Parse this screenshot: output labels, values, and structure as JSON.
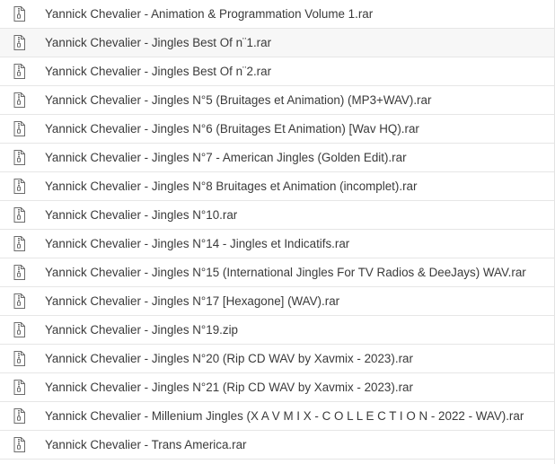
{
  "files": [
    {
      "name": "Yannick Chevalier - Animation & Programmation Volume 1.rar",
      "icon": "archive-file-icon"
    },
    {
      "name": "Yannick Chevalier - Jingles Best Of n¨1.rar",
      "icon": "archive-file-icon"
    },
    {
      "name": "Yannick Chevalier - Jingles Best Of n¨2.rar",
      "icon": "archive-file-icon"
    },
    {
      "name": "Yannick Chevalier - Jingles N°5 (Bruitages et Animation) (MP3+WAV).rar",
      "icon": "archive-file-icon"
    },
    {
      "name": "Yannick Chevalier - Jingles N°6 (Bruitages Et Animation) [Wav HQ).rar",
      "icon": "archive-file-icon"
    },
    {
      "name": "Yannick Chevalier - Jingles N°7 - American Jingles (Golden Edit).rar",
      "icon": "archive-file-icon"
    },
    {
      "name": "Yannick Chevalier - Jingles N°8 Bruitages et Animation (incomplet).rar",
      "icon": "archive-file-icon"
    },
    {
      "name": "Yannick Chevalier - Jingles N°10.rar",
      "icon": "archive-file-icon"
    },
    {
      "name": "Yannick Chevalier - Jingles N°14 - Jingles et Indicatifs.rar",
      "icon": "archive-file-icon"
    },
    {
      "name": "Yannick Chevalier - Jingles N°15 (International Jingles For TV Radios & DeeJays) WAV.rar",
      "icon": "archive-file-icon"
    },
    {
      "name": "Yannick Chevalier - Jingles N°17 [Hexagone] (WAV).rar",
      "icon": "archive-file-icon"
    },
    {
      "name": "Yannick Chevalier - Jingles N°19.zip",
      "icon": "archive-file-icon"
    },
    {
      "name": "Yannick Chevalier - Jingles N°20 (Rip CD WAV by Xavmix - 2023).rar",
      "icon": "archive-file-icon"
    },
    {
      "name": "Yannick Chevalier - Jingles N°21 (Rip CD WAV by Xavmix - 2023).rar",
      "icon": "archive-file-icon"
    },
    {
      "name": "Yannick Chevalier - Millenium Jingles (X A V M I X - C O L L E C T I O N - 2022 - WAV).rar",
      "icon": "archive-file-icon"
    },
    {
      "name": "Yannick Chevalier - Trans America.rar",
      "icon": "archive-file-icon"
    }
  ],
  "colors": {
    "text": "#3a3a3a",
    "icon_stroke": "#6b6b6b",
    "divider": "#e6e6e6",
    "highlight": "#f7f7f7"
  }
}
